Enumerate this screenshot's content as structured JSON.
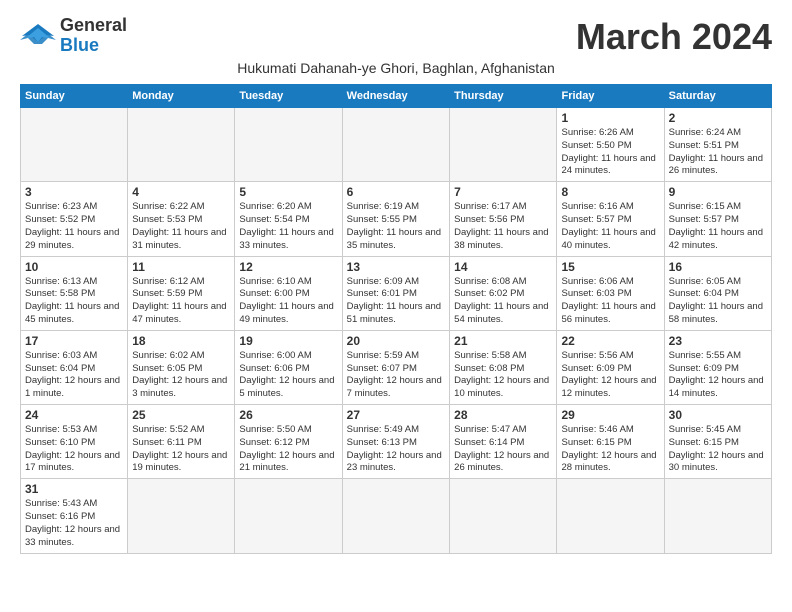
{
  "header": {
    "logo_general": "General",
    "logo_blue": "Blue",
    "month_title": "March 2024",
    "subtitle": "Hukumati Dahanah-ye Ghori, Baghlan, Afghanistan"
  },
  "columns": [
    "Sunday",
    "Monday",
    "Tuesday",
    "Wednesday",
    "Thursday",
    "Friday",
    "Saturday"
  ],
  "weeks": [
    [
      {
        "day": "",
        "info": ""
      },
      {
        "day": "",
        "info": ""
      },
      {
        "day": "",
        "info": ""
      },
      {
        "day": "",
        "info": ""
      },
      {
        "day": "",
        "info": ""
      },
      {
        "day": "1",
        "info": "Sunrise: 6:26 AM\nSunset: 5:50 PM\nDaylight: 11 hours and 24 minutes."
      },
      {
        "day": "2",
        "info": "Sunrise: 6:24 AM\nSunset: 5:51 PM\nDaylight: 11 hours and 26 minutes."
      }
    ],
    [
      {
        "day": "3",
        "info": "Sunrise: 6:23 AM\nSunset: 5:52 PM\nDaylight: 11 hours and 29 minutes."
      },
      {
        "day": "4",
        "info": "Sunrise: 6:22 AM\nSunset: 5:53 PM\nDaylight: 11 hours and 31 minutes."
      },
      {
        "day": "5",
        "info": "Sunrise: 6:20 AM\nSunset: 5:54 PM\nDaylight: 11 hours and 33 minutes."
      },
      {
        "day": "6",
        "info": "Sunrise: 6:19 AM\nSunset: 5:55 PM\nDaylight: 11 hours and 35 minutes."
      },
      {
        "day": "7",
        "info": "Sunrise: 6:17 AM\nSunset: 5:56 PM\nDaylight: 11 hours and 38 minutes."
      },
      {
        "day": "8",
        "info": "Sunrise: 6:16 AM\nSunset: 5:57 PM\nDaylight: 11 hours and 40 minutes."
      },
      {
        "day": "9",
        "info": "Sunrise: 6:15 AM\nSunset: 5:57 PM\nDaylight: 11 hours and 42 minutes."
      }
    ],
    [
      {
        "day": "10",
        "info": "Sunrise: 6:13 AM\nSunset: 5:58 PM\nDaylight: 11 hours and 45 minutes."
      },
      {
        "day": "11",
        "info": "Sunrise: 6:12 AM\nSunset: 5:59 PM\nDaylight: 11 hours and 47 minutes."
      },
      {
        "day": "12",
        "info": "Sunrise: 6:10 AM\nSunset: 6:00 PM\nDaylight: 11 hours and 49 minutes."
      },
      {
        "day": "13",
        "info": "Sunrise: 6:09 AM\nSunset: 6:01 PM\nDaylight: 11 hours and 51 minutes."
      },
      {
        "day": "14",
        "info": "Sunrise: 6:08 AM\nSunset: 6:02 PM\nDaylight: 11 hours and 54 minutes."
      },
      {
        "day": "15",
        "info": "Sunrise: 6:06 AM\nSunset: 6:03 PM\nDaylight: 11 hours and 56 minutes."
      },
      {
        "day": "16",
        "info": "Sunrise: 6:05 AM\nSunset: 6:04 PM\nDaylight: 11 hours and 58 minutes."
      }
    ],
    [
      {
        "day": "17",
        "info": "Sunrise: 6:03 AM\nSunset: 6:04 PM\nDaylight: 12 hours and 1 minute."
      },
      {
        "day": "18",
        "info": "Sunrise: 6:02 AM\nSunset: 6:05 PM\nDaylight: 12 hours and 3 minutes."
      },
      {
        "day": "19",
        "info": "Sunrise: 6:00 AM\nSunset: 6:06 PM\nDaylight: 12 hours and 5 minutes."
      },
      {
        "day": "20",
        "info": "Sunrise: 5:59 AM\nSunset: 6:07 PM\nDaylight: 12 hours and 7 minutes."
      },
      {
        "day": "21",
        "info": "Sunrise: 5:58 AM\nSunset: 6:08 PM\nDaylight: 12 hours and 10 minutes."
      },
      {
        "day": "22",
        "info": "Sunrise: 5:56 AM\nSunset: 6:09 PM\nDaylight: 12 hours and 12 minutes."
      },
      {
        "day": "23",
        "info": "Sunrise: 5:55 AM\nSunset: 6:09 PM\nDaylight: 12 hours and 14 minutes."
      }
    ],
    [
      {
        "day": "24",
        "info": "Sunrise: 5:53 AM\nSunset: 6:10 PM\nDaylight: 12 hours and 17 minutes."
      },
      {
        "day": "25",
        "info": "Sunrise: 5:52 AM\nSunset: 6:11 PM\nDaylight: 12 hours and 19 minutes."
      },
      {
        "day": "26",
        "info": "Sunrise: 5:50 AM\nSunset: 6:12 PM\nDaylight: 12 hours and 21 minutes."
      },
      {
        "day": "27",
        "info": "Sunrise: 5:49 AM\nSunset: 6:13 PM\nDaylight: 12 hours and 23 minutes."
      },
      {
        "day": "28",
        "info": "Sunrise: 5:47 AM\nSunset: 6:14 PM\nDaylight: 12 hours and 26 minutes."
      },
      {
        "day": "29",
        "info": "Sunrise: 5:46 AM\nSunset: 6:15 PM\nDaylight: 12 hours and 28 minutes."
      },
      {
        "day": "30",
        "info": "Sunrise: 5:45 AM\nSunset: 6:15 PM\nDaylight: 12 hours and 30 minutes."
      }
    ],
    [
      {
        "day": "31",
        "info": "Sunrise: 5:43 AM\nSunset: 6:16 PM\nDaylight: 12 hours and 33 minutes."
      },
      {
        "day": "",
        "info": ""
      },
      {
        "day": "",
        "info": ""
      },
      {
        "day": "",
        "info": ""
      },
      {
        "day": "",
        "info": ""
      },
      {
        "day": "",
        "info": ""
      },
      {
        "day": "",
        "info": ""
      }
    ]
  ]
}
